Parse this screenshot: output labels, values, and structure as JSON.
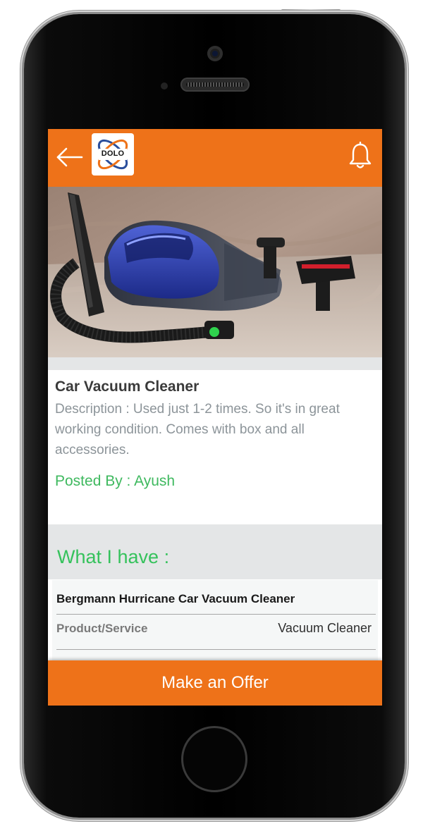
{
  "header": {
    "logo_text": "DOLO",
    "back_icon": "arrow-left-icon",
    "notification_icon": "bell-icon",
    "bar_color": "#ee7219"
  },
  "product": {
    "title": "Car Vacuum Cleaner",
    "description": "Description : Used just 1-2 times. So it's in great working condition. Comes with box and all accessories.",
    "posted_by": "Posted By : Ayush"
  },
  "what_i_have": {
    "heading": "What I have :",
    "item_name": "Bergmann Hurricane Car Vacuum Cleaner",
    "field_label": "Product/Service",
    "field_value": "Vacuum Cleaner"
  },
  "actions": {
    "make_offer_label": "Make an Offer"
  },
  "colors": {
    "accent": "#ee7219",
    "green": "#3fb95f",
    "section_bg": "#e4e6e7"
  }
}
